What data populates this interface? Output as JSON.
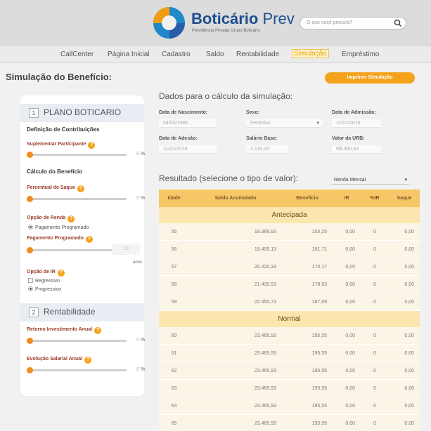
{
  "header": {
    "brand_main": "Boticário",
    "brand_suffix": " Prev",
    "brand_sub": "Previdência Privada Grupo Boticário",
    "search_placeholder": "O que você procura?"
  },
  "nav": [
    "CallCenter",
    "Página Inicial",
    "Cadastro",
    "Saldo",
    "Rentabilidade",
    "Simulação",
    "Empréstimo"
  ],
  "page": {
    "title": "Simulação do Benefício:",
    "print_button": "Imprimir Simulação"
  },
  "panel": {
    "plano": {
      "number": "1",
      "title": "PLANO BOTICARIO"
    },
    "contribuicoes_title": "Definição de Contribuições",
    "suplementar": {
      "label": "Suplementar Participante",
      "value": "0",
      "unit": "%"
    },
    "calculo_title": "Cálculo do Benefício",
    "saque": {
      "label": "Percentual de Saque",
      "value": "0",
      "unit": "%"
    },
    "renda": {
      "label": "Opção de Renda",
      "option": "Pagamento Programado",
      "selected": true
    },
    "programado": {
      "label": "Pagamento Programado",
      "value": "10",
      "unit": "anos"
    },
    "ir": {
      "label": "Opção de IR",
      "options": [
        "Regressivo",
        "Progressivo"
      ],
      "selected": "Progressivo"
    },
    "rentabilidade": {
      "number": "2",
      "title": "Rentabilidade"
    },
    "retorno": {
      "label": "Retorno Investimento Anual",
      "value": "0",
      "unit": "%"
    },
    "salarial": {
      "label": "Evolução Salarial Anual",
      "value": "0",
      "unit": "%"
    }
  },
  "dados": {
    "title": "Dados para o cálculo da simulação:",
    "nascimento": {
      "label": "Data de Nascimento:",
      "value": "04/03/1986"
    },
    "sexo": {
      "label": "Sexo:",
      "value": "Feminino"
    },
    "admissao": {
      "label": "Data de Admissão:",
      "value": "11/01/2016"
    },
    "adesao": {
      "label": "Data de Adesão:",
      "value": "11/01/2016"
    },
    "salario": {
      "label": "Salário Base:",
      "value": "2.115,00"
    },
    "urb": {
      "label": "Valor da URB:",
      "value": "R$ 480,64"
    }
  },
  "resultado": {
    "title": "Resultado (selecione o tipo de valor):",
    "select": "Renda Mensal",
    "columns": [
      "Idade",
      "Saldo Acumulado",
      "Benefício",
      "IR",
      "%IR",
      "Saque"
    ],
    "antecipada_label": "Antecipada",
    "antecipada": [
      [
        "55",
        "18.389,93",
        "153,25",
        "0,00",
        "0",
        "0,00"
      ],
      [
        "56",
        "19.405,13",
        "161,71",
        "0,00",
        "0",
        "0,00"
      ],
      [
        "57",
        "20.420,33",
        "170,17",
        "0,00",
        "0",
        "0,00"
      ],
      [
        "58",
        "21.435,53",
        "178,63",
        "0,00",
        "0",
        "0,00"
      ],
      [
        "59",
        "22.450,73",
        "187,09",
        "0,00",
        "0",
        "0,00"
      ]
    ],
    "normal_label": "Normal",
    "normal": [
      [
        "60",
        "23.465,93",
        "195,55",
        "0,00",
        "0",
        "0,00"
      ],
      [
        "61",
        "23.465,93",
        "195,55",
        "0,00",
        "0",
        "0,00"
      ],
      [
        "62",
        "23.465,93",
        "195,55",
        "0,00",
        "0",
        "0,00"
      ],
      [
        "63",
        "23.465,93",
        "195,55",
        "0,00",
        "0",
        "0,00"
      ],
      [
        "64",
        "23.465,93",
        "195,55",
        "0,00",
        "0",
        "0,00"
      ],
      [
        "65",
        "23.465,93",
        "195,55",
        "0,00",
        "0",
        "0,00"
      ]
    ]
  }
}
